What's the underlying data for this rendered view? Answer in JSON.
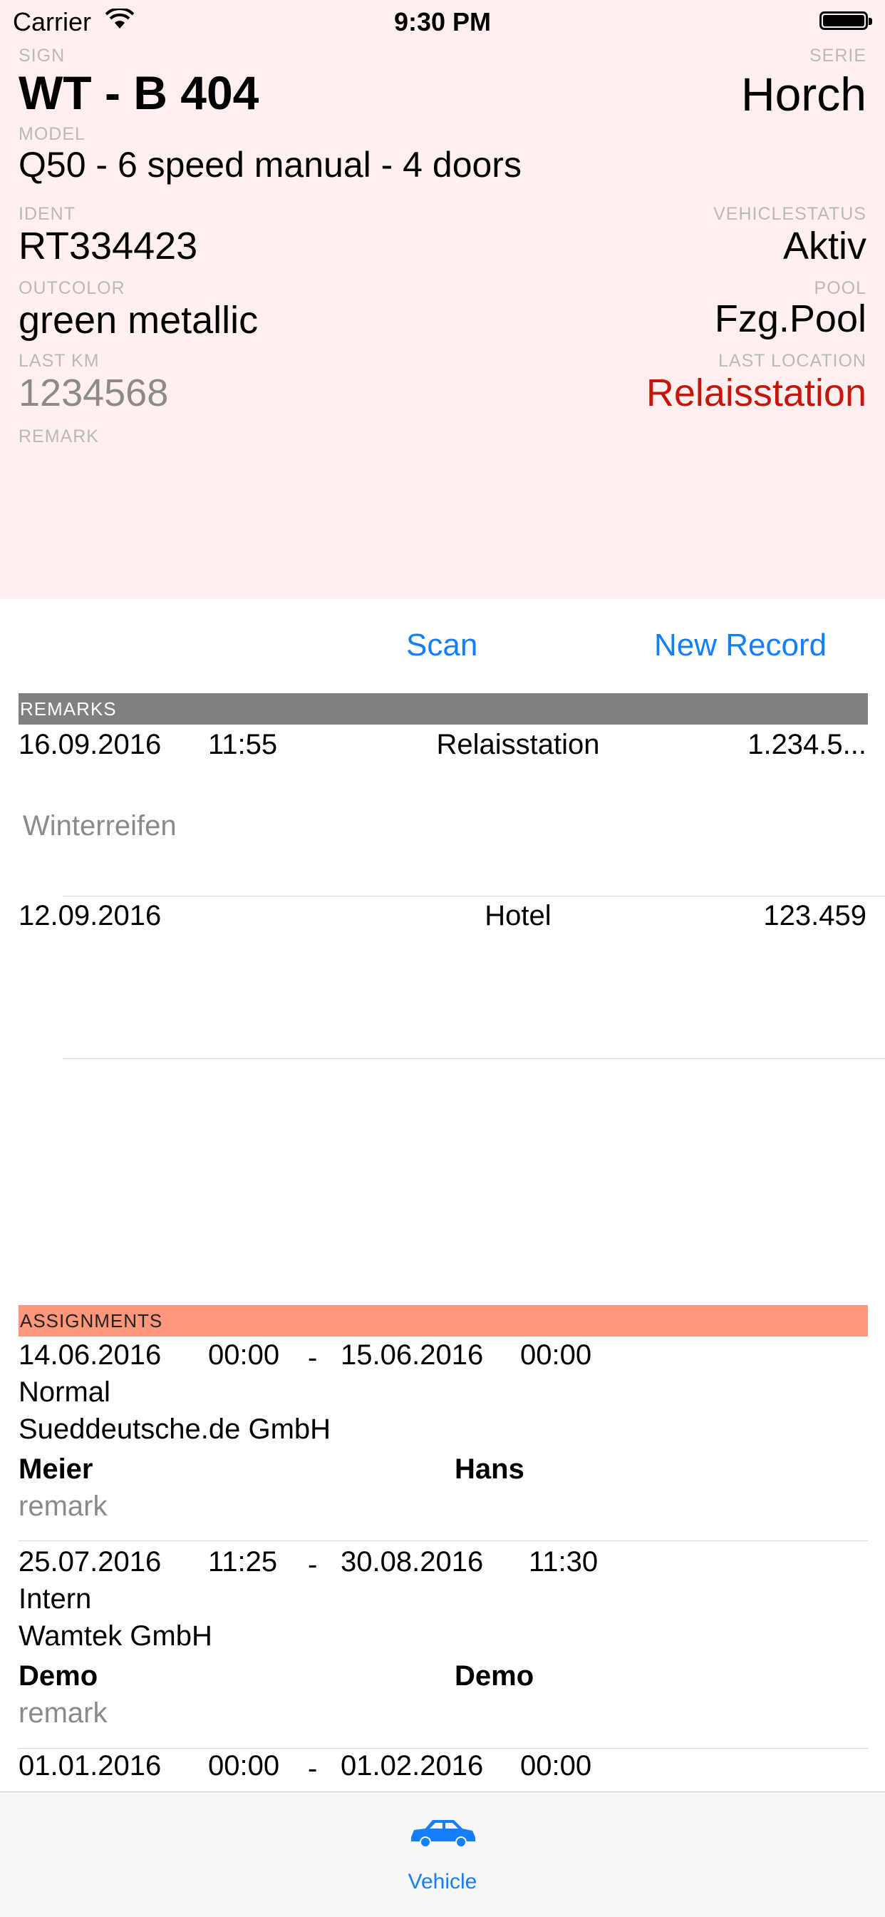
{
  "status_bar": {
    "carrier": "Carrier",
    "time": "9:30 PM"
  },
  "vehicle": {
    "sign_label": "SIGN",
    "sign": "WT - B 404",
    "serie_label": "SERIE",
    "serie": "Horch",
    "model_label": "MODEL",
    "model": "Q50 - 6 speed manual - 4 doors",
    "ident_label": "IDENT",
    "ident": "RT334423",
    "status_label": "VEHICLESTATUS",
    "status": "Aktiv",
    "outcolor_label": "OUTCOLOR",
    "outcolor": "green metallic",
    "pool_label": "POOL",
    "pool": "Fzg.Pool",
    "lastkm_label": "LAST KM",
    "lastkm": "1234568",
    "lastloc_label": "LAST LOCATION",
    "lastloc": "Relaisstation",
    "remark_label": "REMARK"
  },
  "actions": {
    "scan": "Scan",
    "new_record": "New Record"
  },
  "remarks": {
    "header": "REMARKS",
    "items": [
      {
        "date": "16.09.2016",
        "time": "11:55",
        "location": "Relaisstation",
        "km": "1.234.5...",
        "note": "Winterreifen"
      },
      {
        "date": "12.09.2016",
        "time": "",
        "location": "Hotel",
        "km": "123.459",
        "note": ""
      }
    ]
  },
  "assignments": {
    "header": "ASSIGNMENTS",
    "items": [
      {
        "from_date": "14.06.2016",
        "from_time": "00:00",
        "dash": "-",
        "to_date": "15.06.2016",
        "to_time": "00:00",
        "type": "Normal",
        "company": "Sueddeutsche.de GmbH",
        "last_name": "Meier",
        "first_name": "Hans",
        "remark": "remark"
      },
      {
        "from_date": "25.07.2016",
        "from_time": "11:25",
        "dash": "-",
        "to_date": "30.08.2016",
        "to_time": "11:30",
        "type": "Intern",
        "company": "Wamtek GmbH",
        "last_name": "Demo",
        "first_name": "Demo",
        "remark": "remark"
      },
      {
        "from_date": "01.01.2016",
        "from_time": "00:00",
        "dash": "-",
        "to_date": "01.02.2016",
        "to_time": "00:00"
      }
    ]
  },
  "tabbar": {
    "vehicle_label": "Vehicle",
    "icon": "car-icon"
  },
  "colors": {
    "accent": "#147efb",
    "card_bg": "#fff0ef",
    "remarks_header": "#808080",
    "assign_header": "#ff977c",
    "alert": "#c5160d"
  }
}
